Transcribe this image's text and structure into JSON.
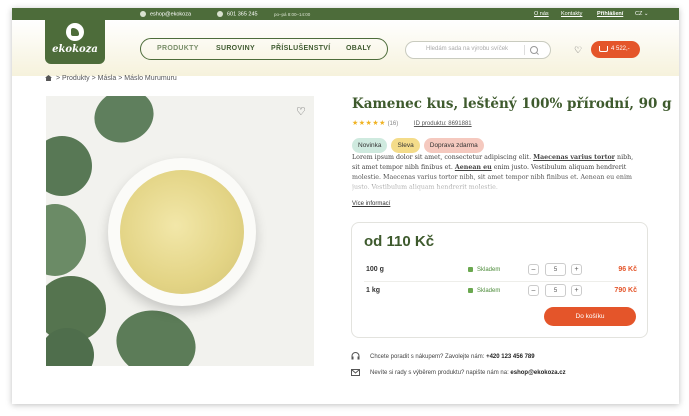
{
  "topbar": {
    "email": "eshop@ekokoza",
    "phone": "601 365 245",
    "hours": "po–pá 8:00–14:00",
    "links": [
      "O nás",
      "Kontakty",
      "Přihlášení"
    ],
    "currency": "CZ"
  },
  "logo": {
    "text": "ekokoza"
  },
  "nav": {
    "items": [
      "PRODUKTY",
      "SUROVINY",
      "PŘÍSLUŠENSTVÍ",
      "OBALY"
    ]
  },
  "search": {
    "placeholder": "Hledám sada na výrobu svíček"
  },
  "cart": {
    "total": "4 522,-"
  },
  "breadcrumb": {
    "text": "> Produkty > Másla > Máslo Murumuru"
  },
  "product": {
    "title": "Kamenec kus, leštěný 100% přírodní, 90 g",
    "rating_count": "(16)",
    "product_id": "ID produktu: 8691881",
    "badges": [
      {
        "label": "Novinka",
        "color": "#cfeadf"
      },
      {
        "label": "Sleva",
        "color": "#f4dc8a"
      },
      {
        "label": "Doprava zdarma",
        "color": "#f5c9bf"
      }
    ],
    "desc": {
      "p1": "Lorem ipsum dolor sit amet, consectetur adipiscing elit. ",
      "b1": "Maecenas varius tortor",
      "p2": " nibh, sit amet tempor nibh finibus et. ",
      "b2": "Aenean eu",
      "p3": " enim justo. Vestibulum aliquam hendrerit molestie. Maecenas varius tortor nibh, sit amet tempor nibh finibus et. Aenean eu enim justo. Vestibulum aliquam hendrerit molestie."
    },
    "more_label": "Více informací",
    "price": "od 110 Kč",
    "variants": [
      {
        "size": "100 g",
        "stock": "Skladem",
        "qty": "5",
        "price": "96 Kč"
      },
      {
        "size": "1 kg",
        "stock": "Skladem",
        "qty": "5",
        "price": "790 Kč"
      }
    ],
    "add_label": "Do košíku"
  },
  "contact": {
    "phone_text": "Chcete poradit s nákupem? Zavolejte nám: ",
    "phone": "+420 123 456 789",
    "email_text": "Nevíte si rady s výběrem produktu? napište nám na: ",
    "email": "eshop@ekokoza.cz"
  },
  "colors": {
    "brand": "#4d6c3a",
    "accent": "#e4552a",
    "star": "#f0b323"
  }
}
